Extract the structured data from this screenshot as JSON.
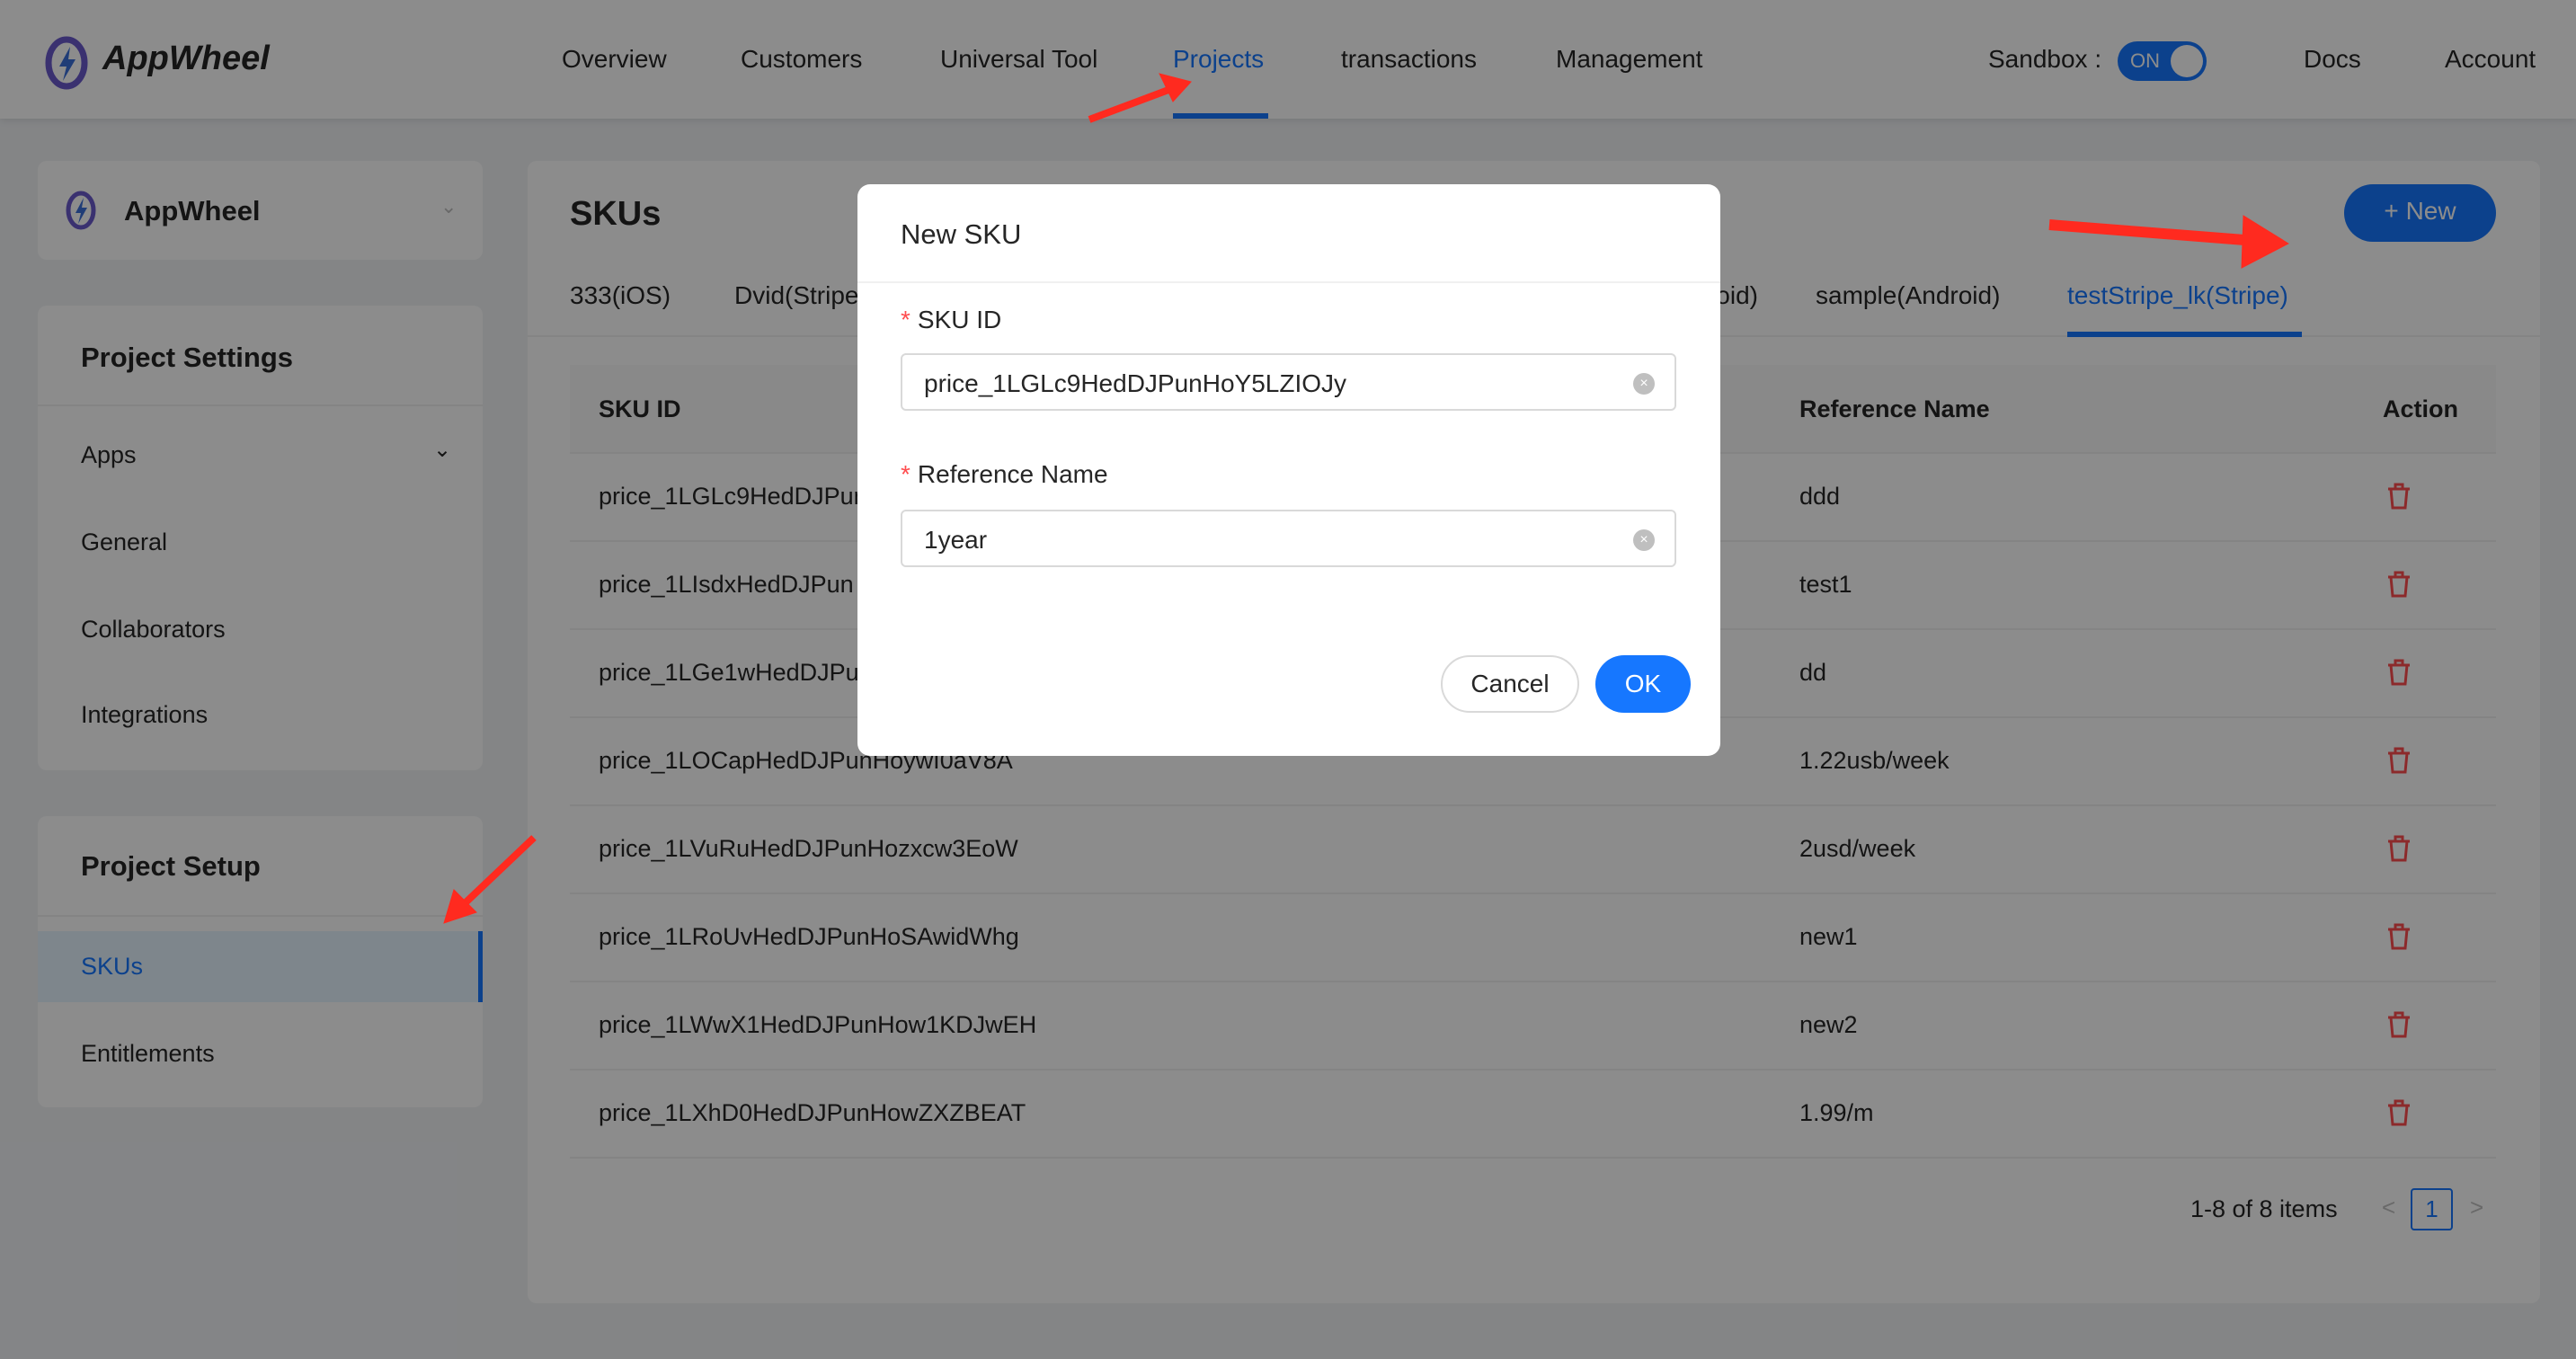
{
  "header": {
    "brand": "AppWheel",
    "nav": [
      "Overview",
      "Customers",
      "Universal Tool",
      "Projects",
      "transactions",
      "Management"
    ],
    "active_nav": "Projects",
    "sandbox_label": "Sandbox :",
    "sandbox_toggle": "ON",
    "docs": "Docs",
    "account": "Account"
  },
  "sidebar": {
    "project_name": "AppWheel",
    "settings_title": "Project Settings",
    "settings_items": [
      "Apps",
      "General",
      "Collaborators",
      "Integrations"
    ],
    "setup_title": "Project Setup",
    "setup_items": [
      "SKUs",
      "Entitlements"
    ],
    "active_item": "SKUs"
  },
  "main": {
    "title": "SKUs",
    "new_button": "New",
    "tabs": [
      "333(iOS)",
      "Dvid(Stripe)",
      "(Android)",
      "sample(Android)",
      "testStripe_lk(Stripe)"
    ],
    "active_tab": "testStripe_lk(Stripe)",
    "columns": [
      "SKU ID",
      "Reference Name",
      "Action"
    ],
    "rows": [
      {
        "sku": "price_1LGLc9HedDJPunHoY5LZIOJy",
        "ref": "ddd"
      },
      {
        "sku": "price_1LIsdxHedDJPun",
        "ref": "test1"
      },
      {
        "sku": "price_1LGe1wHedDJPun",
        "ref": "dd"
      },
      {
        "sku": "price_1LOCapHedDJPunHoywI0aV8A",
        "ref": "1.22usb/week"
      },
      {
        "sku": "price_1LVuRuHedDJPunHozxcw3EoW",
        "ref": "2usd/week"
      },
      {
        "sku": "price_1LRoUvHedDJPunHoSAwidWhg",
        "ref": "new1"
      },
      {
        "sku": "price_1LWwX1HedDJPunHow1KDJwEH",
        "ref": "new2"
      },
      {
        "sku": "price_1LXhD0HedDJPunHowZXZBEAT",
        "ref": "1.99/m"
      }
    ],
    "pagination": {
      "summary": "1-8 of 8 items",
      "current_page": "1"
    }
  },
  "modal": {
    "title": "New SKU",
    "sku_label": "SKU ID",
    "sku_value": "price_1LGLc9HedDJPunHoY5LZIOJy",
    "ref_label": "Reference Name",
    "ref_value": "1year",
    "cancel": "Cancel",
    "ok": "OK"
  },
  "colors": {
    "primary": "#1677ff",
    "danger": "#ff4d4f",
    "annotation_arrow": "#ff2a1f"
  }
}
